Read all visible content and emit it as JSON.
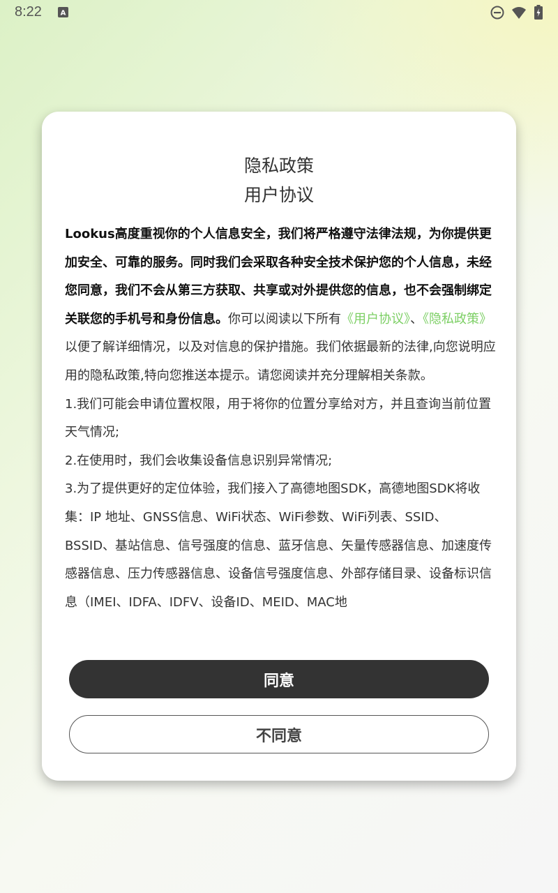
{
  "status_bar": {
    "time": "8:22",
    "icons": [
      "notification-a-icon",
      "do-not-disturb-icon",
      "wifi-icon",
      "battery-charging-icon"
    ]
  },
  "dialog": {
    "title_privacy": "隐私政策",
    "title_agreement": "用户协议",
    "intro_bold": "Lookus高度重视你的个人信息安全，我们将严格遵守法律法规，为你提供更加安全、可靠的服务。同时我们会采取各种安全技术保护您的个人信息，未经您同意，我们不会从第三方获取、共享或对外提供您的信息，也不会强制绑定关联您的手机号和身份信息。",
    "intro_read": "你可以阅读以下所有",
    "link_user_agreement": "《用户协议》",
    "separator": "、",
    "link_privacy_policy": "《隐私政策》",
    "intro_rest": "以便了解详细情况，以及对信息的保护措施。我们依据最新的法律,向您说明应用的隐私政策,特向您推送本提示。请您阅读并充分理解相关条款。",
    "item_1": "1.我们可能会申请位置权限，用于将你的位置分享给对方，并且查询当前位置天气情况;",
    "item_2": "2.在使用时，我们会收集设备信息识别异常情况;",
    "item_3": "3.为了提供更好的定位体验，我们接入了高德地图SDK，高德地图SDK将收集：IP 地址、GNSS信息、WiFi状态、WiFi参数、WiFi列表、SSID、BSSID、基站信息、信号强度的信息、蓝牙信息、矢量传感器信息、加速度传感器信息、压力传感器信息、设备信号强度信息、外部存储目录、设备标识信息（IMEI、IDFA、IDFV、设备ID、MEID、MAC地",
    "agree_label": "同意",
    "disagree_label": "不同意"
  },
  "colors": {
    "link": "#7ccf64",
    "primary_button": "#333333",
    "background_tint": "#dcf1c6"
  }
}
